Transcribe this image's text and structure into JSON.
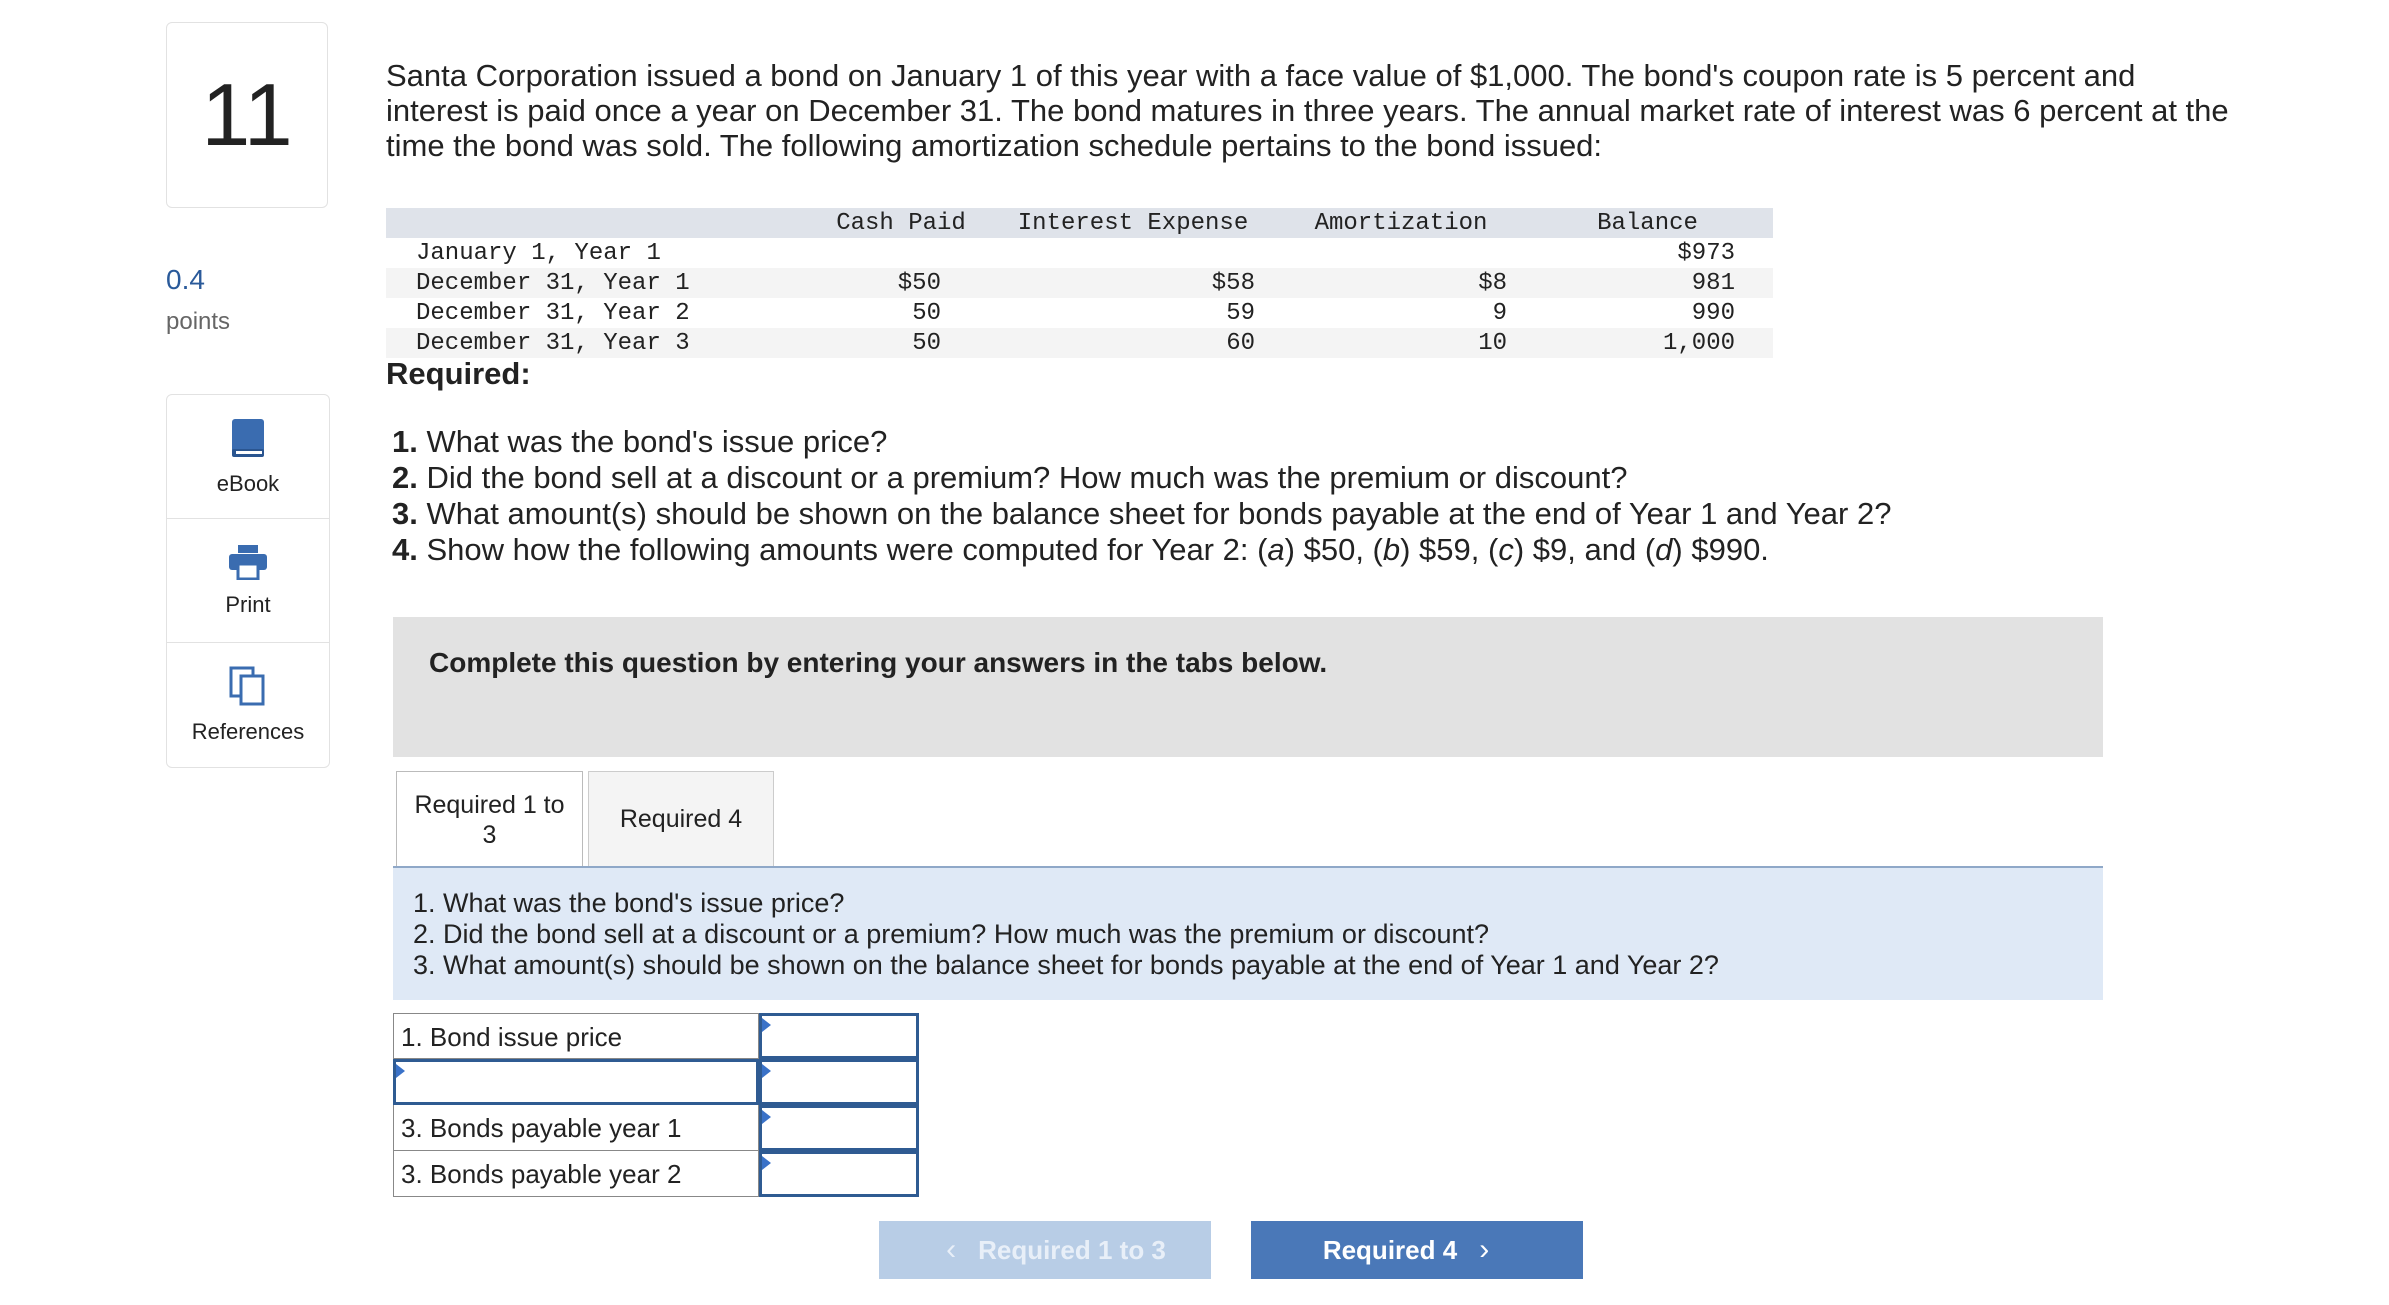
{
  "question_number": "11",
  "points": {
    "value": "0.4",
    "label": "points"
  },
  "tools": [
    {
      "label": "eBook",
      "icon": "book-icon"
    },
    {
      "label": "Print",
      "icon": "printer-icon"
    },
    {
      "label": "References",
      "icon": "copy-documents-icon"
    }
  ],
  "intro": {
    "line1": "Santa Corporation issued a bond on January 1 of this year with a face value of $1,000. The bond's coupon rate is 5 percent and",
    "line2": "interest is paid once a year on December 31. The bond matures in three years. The annual market rate of interest was 6 percent at the",
    "line3": "time the bond was sold. The following amortization schedule pertains to the bond issued:"
  },
  "schedule": {
    "headers": [
      "",
      "Cash Paid",
      "Interest Expense",
      "Amortization",
      "Balance"
    ],
    "rows": [
      [
        "January 1, Year 1",
        "",
        "",
        "",
        "$973"
      ],
      [
        "December 31, Year 1",
        "$50",
        "$58",
        "$8",
        "981"
      ],
      [
        "December 31, Year 2",
        "50",
        "59",
        "9",
        "990"
      ],
      [
        "December 31, Year 3",
        "50",
        "60",
        "10",
        "1,000"
      ]
    ]
  },
  "required_heading": "Required:",
  "questions": {
    "q1_num": "1.",
    "q1_text": "What was the bond's issue price?",
    "q2_num": "2.",
    "q2_text": "Did the bond sell at a discount or a premium? How much was the premium or discount?",
    "q3_num": "3.",
    "q3_text": "What amount(s) should be shown on the balance sheet for bonds payable at the end of Year 1 and Year 2?",
    "q4_num": "4.",
    "q4_pre": "Show how the following amounts were computed for Year 2: (",
    "q4_a": "a",
    "q4_a_val": ") $50, (",
    "q4_b": "b",
    "q4_b_val": ") $59, (",
    "q4_c": "c",
    "q4_c_val": ") $9, and (",
    "q4_d": "d",
    "q4_d_val": ") $990."
  },
  "banner_text": "Complete this question by entering your answers in the tabs below.",
  "tabs": [
    {
      "label_line1": "Required 1 to",
      "label_line2": "3"
    },
    {
      "label": "Required 4"
    }
  ],
  "instructions": [
    "1. What was the bond's issue price?",
    "2. Did the bond sell at a discount or a premium? How much was the premium or discount?",
    "3. What amount(s) should be shown on the balance sheet for bonds payable at the end of Year 1 and Year 2?"
  ],
  "answer_rows": [
    {
      "label": "1. Bond issue price",
      "value": ""
    },
    {
      "label": "",
      "value": ""
    },
    {
      "label": "3. Bonds payable year 1",
      "value": ""
    },
    {
      "label": "3. Bonds payable year 2",
      "value": ""
    }
  ],
  "nav": {
    "prev_label": "Required 1 to 3",
    "next_label": "Required 4"
  },
  "colors": {
    "accent": "#4a78b8",
    "accent_disabled": "#b8cde6",
    "points": "#2a5a9a"
  }
}
